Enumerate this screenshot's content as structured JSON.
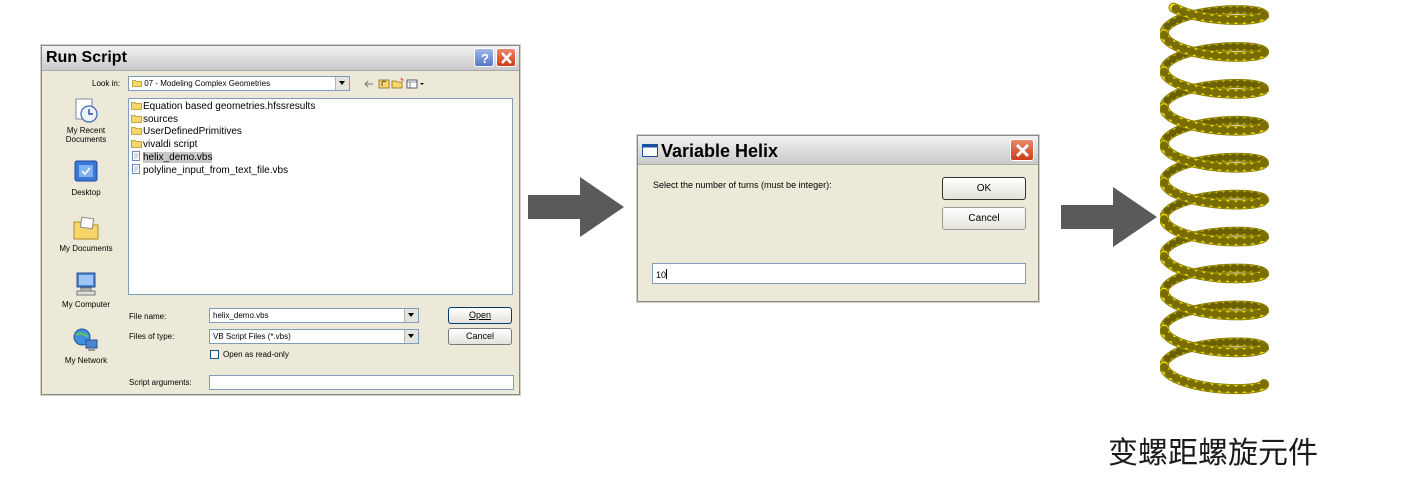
{
  "run_script": {
    "title": "Run Script",
    "look_in_label": "Look in:",
    "look_in_value": "07 - Modeling Complex Geometries",
    "places": [
      {
        "label": "My Recent Documents",
        "icon": "recent-documents-icon"
      },
      {
        "label": "Desktop",
        "icon": "desktop-icon"
      },
      {
        "label": "My Documents",
        "icon": "my-documents-icon"
      },
      {
        "label": "My Computer",
        "icon": "my-computer-icon"
      },
      {
        "label": "My Network",
        "icon": "my-network-icon"
      }
    ],
    "files": [
      {
        "name": "Equation based geometries.hfssresults",
        "type": "folder"
      },
      {
        "name": "sources",
        "type": "folder"
      },
      {
        "name": "UserDefinedPrimitives",
        "type": "folder"
      },
      {
        "name": "vivaldi script",
        "type": "folder"
      },
      {
        "name": "helix_demo.vbs",
        "type": "script",
        "selected": true
      },
      {
        "name": "polyline_input_from_text_file.vbs",
        "type": "script"
      }
    ],
    "file_name_label": "File name:",
    "file_name_value": "helix_demo.vbs",
    "files_of_type_label": "Files of type:",
    "files_of_type_value": "VB Script Files (*.vbs)",
    "read_only_label": "Open as read-only",
    "script_args_label": "Script arguments:",
    "script_args_value": "",
    "open_label": "Open",
    "cancel_label": "Cancel"
  },
  "variable_helix": {
    "title": "Variable Helix",
    "prompt": "Select the number of turns (must be integer):",
    "ok_label": "OK",
    "cancel_label": "Cancel",
    "input_value": "10"
  },
  "helix": {
    "turns": 10,
    "color": "#f2e600"
  },
  "caption": "变螺距螺旋元件",
  "colors": {
    "arrow": "#5a5a5a",
    "close_button": "#d9472b",
    "selection": "#c8c8c8"
  }
}
